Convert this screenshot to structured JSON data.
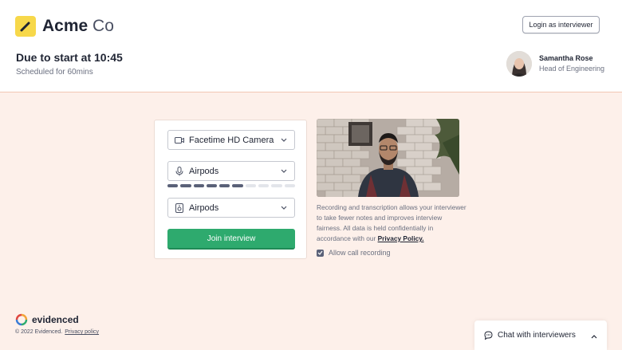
{
  "header": {
    "logo_bold": "Acme",
    "logo_light": "Co",
    "login_label": "Login as interviewer"
  },
  "meeting": {
    "title": "Due to start at 10:45",
    "subtitle": "Scheduled for 60mins"
  },
  "interviewer": {
    "name": "Samantha Rose",
    "role": "Head of Engineering"
  },
  "devices": {
    "camera": "Facetime HD Camera",
    "microphone": "Airpods",
    "speaker": "Airpods",
    "mic_level_segments_on": 6,
    "mic_level_segments_total": 10
  },
  "join_label": "Join interview",
  "recording_note": "Recording and transcription allows your interviewer to take fewer notes and improves interview fairness. All data is held confidentially in accordance with our",
  "privacy_link": "Privacy Policy.",
  "allow_recording_label": "Allow call recording",
  "allow_recording_checked": true,
  "footer": {
    "brand": "evidenced",
    "copyright": "© 2022 Evidenced.",
    "privacy_label": "Privacy policy"
  },
  "chat": {
    "label": "Chat with interviewers"
  },
  "colors": {
    "page_bg": "#fdf0ea",
    "accent_green": "#2eaa6e",
    "logo_yellow": "#f7d84a"
  }
}
